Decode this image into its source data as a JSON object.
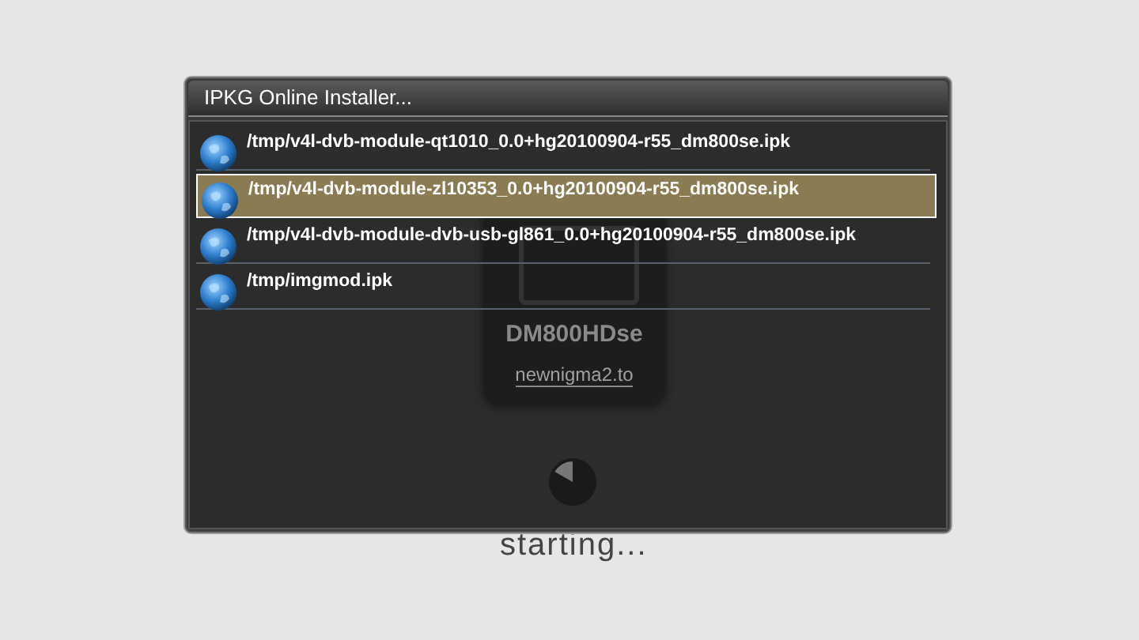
{
  "window": {
    "title": "IPKG Online Installer..."
  },
  "list": {
    "items": [
      {
        "label": "/tmp/v4l-dvb-module-qt1010_0.0+hg20100904-r55_dm800se.ipk",
        "selected": false
      },
      {
        "label": "/tmp/v4l-dvb-module-zl10353_0.0+hg20100904-r55_dm800se.ipk",
        "selected": true
      },
      {
        "label": "/tmp/v4l-dvb-module-dvb-usb-gl861_0.0+hg20100904-r55_dm800se.ipk",
        "selected": false
      },
      {
        "label": "/tmp/imgmod.ipk",
        "selected": false
      }
    ]
  },
  "background": {
    "device_label": "DM800HDse",
    "brand": "newnigma2.to"
  },
  "boot_status": "starting..."
}
